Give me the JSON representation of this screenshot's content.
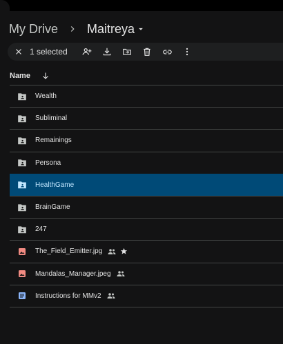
{
  "breadcrumb": {
    "root": "My Drive",
    "current": "Maitreya"
  },
  "action_bar": {
    "selected_label": "1 selected",
    "icons": [
      "close-icon",
      "share-icon",
      "download-icon",
      "move-icon",
      "trash-icon",
      "link-icon",
      "more-vert-icon"
    ]
  },
  "list_header": {
    "name_label": "Name"
  },
  "files": [
    {
      "name": "Wealth",
      "type": "folder"
    },
    {
      "name": "Subliminal",
      "type": "folder"
    },
    {
      "name": "Remainings",
      "type": "folder"
    },
    {
      "name": "Persona",
      "type": "folder"
    },
    {
      "name": "HealthGame",
      "type": "folder",
      "selected": true
    },
    {
      "name": "BrainGame",
      "type": "folder"
    },
    {
      "name": "247",
      "type": "folder"
    },
    {
      "name": "The_Field_Emitter.jpg",
      "type": "image",
      "shared": true,
      "starred": true
    },
    {
      "name": "Mandalas_Manager.jpeg",
      "type": "image",
      "shared": true
    },
    {
      "name": "Instructions for MMv2",
      "type": "doc",
      "shared": true
    }
  ],
  "colors": {
    "background": "#131314",
    "selected_row": "#004a77",
    "image_icon": "#f28b82",
    "doc_icon": "#8ab4f8"
  }
}
